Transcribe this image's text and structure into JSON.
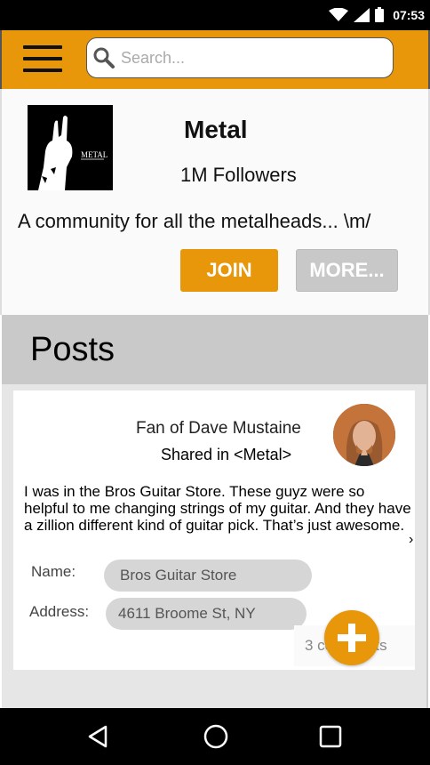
{
  "status_bar": {
    "time": "07:53",
    "icons": [
      "wifi-icon",
      "signal-icon",
      "battery-icon"
    ]
  },
  "app_bar": {
    "menu_icon": "hamburger-menu-icon",
    "search": {
      "placeholder": "Search...",
      "value": ""
    }
  },
  "community": {
    "logo_text": "METAL",
    "title": "Metal",
    "followers": "1M Followers",
    "description": "A community for all the metalheads... \\m/",
    "join_label": "JOIN",
    "more_label": "MORE..."
  },
  "posts": {
    "heading": "Posts",
    "items": [
      {
        "author": "Fan of Dave Mustaine",
        "shared_in": "Shared in <Metal>",
        "body": "I was in the Bros Guitar Store. These guyz were so helpful to me changing strings of my guitar. And they have a zillion different kind of guitar pick. That’s just awesome.",
        "name_label": "Name:",
        "name_value": "Bros Guitar Store",
        "address_label": "Address:",
        "address_value": "4611 Broome St, NY",
        "comments": "3 comments"
      }
    ]
  },
  "stray_mark": "›",
  "fab": {
    "icon": "plus-icon"
  },
  "nav": {
    "icons": [
      "back-icon",
      "home-icon",
      "recents-icon"
    ]
  },
  "colors": {
    "accent": "#e8960a",
    "posts_header": "#c9c9c9",
    "field_bg": "#d6d6d6"
  }
}
